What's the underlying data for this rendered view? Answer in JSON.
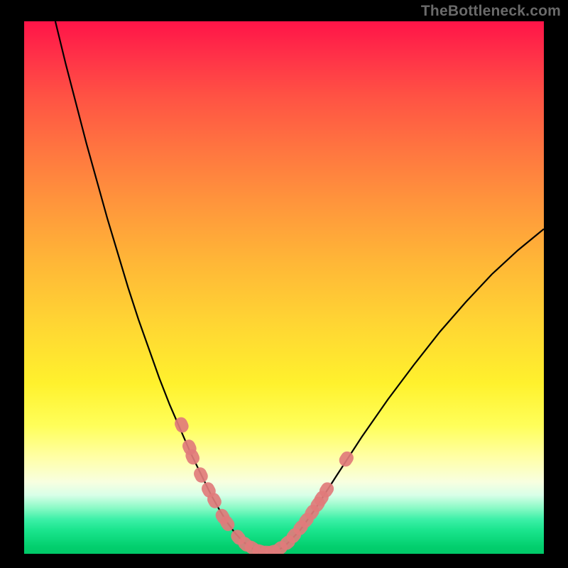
{
  "watermark": "TheBottleneck.com",
  "chart_data": {
    "type": "line",
    "title": "",
    "xlabel": "",
    "ylabel": "",
    "xlim": [
      0,
      100
    ],
    "ylim": [
      0,
      100
    ],
    "series": [
      {
        "name": "bottleneck-curve",
        "x": [
          6,
          8,
          10,
          12,
          14,
          16,
          18,
          20,
          22,
          24,
          26,
          28,
          30,
          32,
          34,
          36,
          37.5,
          39,
          40.5,
          42,
          43.5,
          45,
          46.5,
          48,
          50,
          53,
          56,
          60,
          65,
          70,
          75,
          80,
          85,
          90,
          95,
          100
        ],
        "y": [
          100,
          92,
          84.5,
          77,
          70,
          63,
          56.5,
          50,
          44,
          38.5,
          33,
          28,
          23.5,
          19,
          15,
          11,
          8.4,
          6,
          4,
          2.4,
          1.2,
          0.5,
          0.2,
          0.3,
          1.3,
          4.3,
          8.4,
          14.5,
          22,
          29,
          35.5,
          41.7,
          47.3,
          52.5,
          57,
          61
        ]
      }
    ],
    "markers": {
      "name": "highlighted-points",
      "color": "#e17b7b",
      "points": [
        {
          "x": 30.3,
          "y": 24.2
        },
        {
          "x": 31.8,
          "y": 20.0
        },
        {
          "x": 32.4,
          "y": 18.2
        },
        {
          "x": 34.0,
          "y": 14.8
        },
        {
          "x": 35.5,
          "y": 12.0
        },
        {
          "x": 36.6,
          "y": 10.0
        },
        {
          "x": 38.2,
          "y": 7.0
        },
        {
          "x": 39.1,
          "y": 5.7
        },
        {
          "x": 41.2,
          "y": 3.1
        },
        {
          "x": 42.6,
          "y": 1.8
        },
        {
          "x": 43.9,
          "y": 1.1
        },
        {
          "x": 45.4,
          "y": 0.5
        },
        {
          "x": 46.7,
          "y": 0.3
        },
        {
          "x": 47.8,
          "y": 0.4
        },
        {
          "x": 49.2,
          "y": 1.0
        },
        {
          "x": 50.7,
          "y": 2.1
        },
        {
          "x": 51.9,
          "y": 3.4
        },
        {
          "x": 53.2,
          "y": 4.9
        },
        {
          "x": 54.3,
          "y": 6.3
        },
        {
          "x": 55.4,
          "y": 7.8
        },
        {
          "x": 56.5,
          "y": 9.3
        },
        {
          "x": 57.2,
          "y": 10.4
        },
        {
          "x": 58.2,
          "y": 12.0
        },
        {
          "x": 62.0,
          "y": 17.8
        }
      ]
    },
    "background_gradient": {
      "direction": "vertical",
      "stops": [
        {
          "pos": 0.0,
          "color": "#ff1448"
        },
        {
          "pos": 0.3,
          "color": "#ff8a3e"
        },
        {
          "pos": 0.6,
          "color": "#ffe032"
        },
        {
          "pos": 0.82,
          "color": "#ffffa8"
        },
        {
          "pos": 0.9,
          "color": "#9cf9cc"
        },
        {
          "pos": 1.0,
          "color": "#00c968"
        }
      ]
    }
  }
}
